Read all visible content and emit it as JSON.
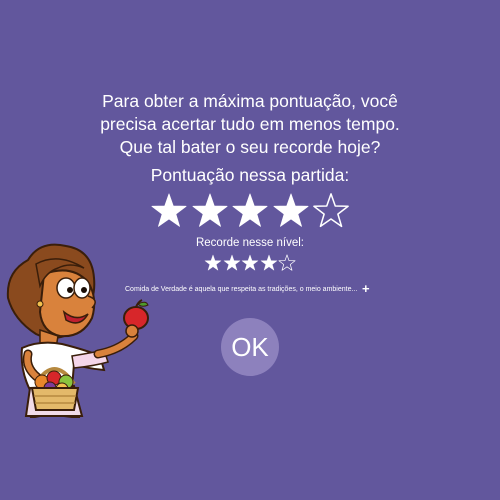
{
  "intro_text": "Para obter a máxima pontuação, você\nprecisa acertar tudo em menos tempo.\nQue tal bater o seu recorde hoje?",
  "score": {
    "label": "Pontuação nessa partida:",
    "stars_filled": 4,
    "stars_total": 5
  },
  "record": {
    "label": "Recorde nesse nível:",
    "stars_filled": 4,
    "stars_total": 5
  },
  "tip": {
    "text": "Comida de Verdade é aquela que respeita as tradições, o meio ambiente...",
    "expand_label": "+"
  },
  "ok_button": {
    "label": "OK"
  },
  "colors": {
    "background": "#62579d",
    "text": "#ffffff",
    "button": "#8d81bd"
  },
  "icons": {
    "star_filled": "star-filled-icon",
    "star_empty": "star-outline-icon",
    "character": "woman-with-apple-and-fruit-basket-illustration"
  }
}
